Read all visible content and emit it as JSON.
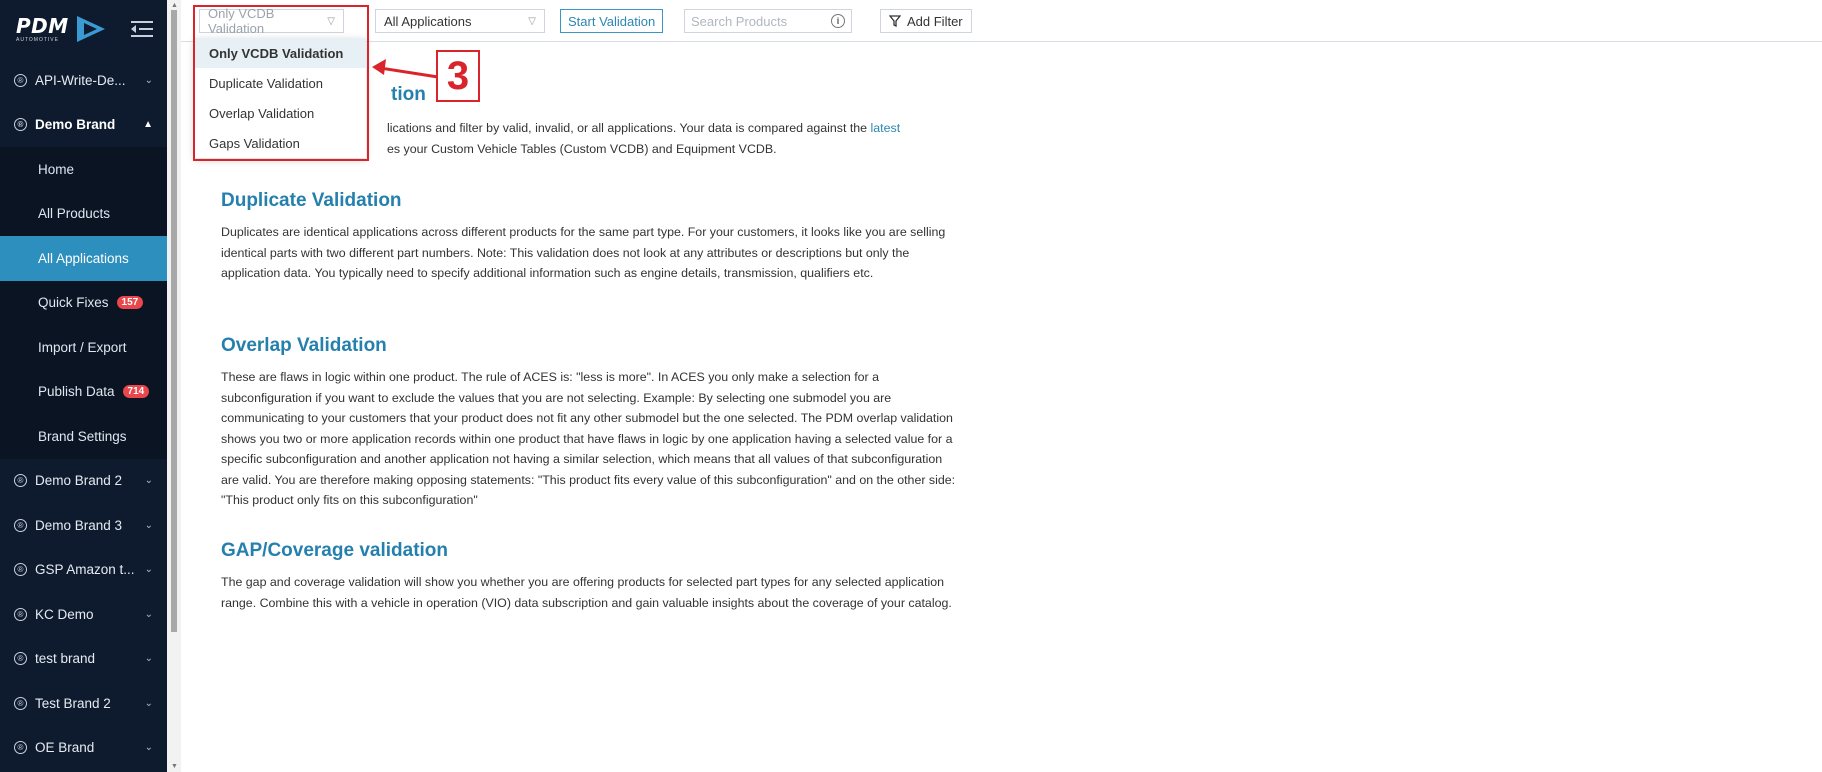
{
  "colors": {
    "sidebar_bg": "#0e1b2e",
    "active_item": "#2c8fbe",
    "accent": "#2580ad",
    "badge": "#e9474b",
    "annotation": "#d9242b"
  },
  "logo": {
    "text": "PDM",
    "sub": "AUTOMOTIVE"
  },
  "sidebar": {
    "brands_top": [
      {
        "label": "API-Write-De...",
        "icon": "registered-icon"
      }
    ],
    "open_brand": {
      "label": "Demo Brand",
      "icon": "registered-icon"
    },
    "sub_items": [
      {
        "label": "Home"
      },
      {
        "label": "All Products"
      },
      {
        "label": "All Applications",
        "active": true
      },
      {
        "label": "Quick Fixes",
        "badge": "157"
      },
      {
        "label": "Import / Export"
      },
      {
        "label": "Publish Data",
        "badge": "714"
      },
      {
        "label": "Brand Settings"
      }
    ],
    "brands_bottom": [
      {
        "label": "Demo Brand 2"
      },
      {
        "label": "Demo Brand 3"
      },
      {
        "label": "GSP Amazon t..."
      },
      {
        "label": "KC Demo"
      },
      {
        "label": "test brand"
      },
      {
        "label": "Test Brand 2"
      },
      {
        "label": "OE Brand"
      }
    ]
  },
  "toolbar": {
    "validation_select": "Only VCDB Validation",
    "applications_select": "All Applications",
    "start_button": "Start Validation",
    "search_placeholder": "Search Products",
    "filter_button": "Add Filter"
  },
  "dropdown": {
    "options": [
      "Only VCDB Validation",
      "Duplicate Validation",
      "Overlap Validation",
      "Gaps Validation"
    ],
    "selected": "Only VCDB Validation"
  },
  "annotation": {
    "number": "3"
  },
  "content": {
    "vcdb_title_fragment": "tion",
    "vcdb_line1_a": "lications and filter by valid, invalid, or all applications. Your data is compared against the ",
    "vcdb_line1_link": "latest",
    "vcdb_line2": "es your Custom Vehicle Tables (Custom VCDB) and Equipment VCDB.",
    "duplicate_title": "Duplicate Validation",
    "duplicate_text": "Duplicates are identical applications across different products for the same part type. For your customers, it looks like you are selling identical parts with two different part numbers. Note: This validation does not look at any attributes or descriptions but only the application data. You typically need to specify additional information such as engine details, transmission, qualifiers etc.",
    "overlap_title": "Overlap Validation",
    "overlap_text": "These are flaws in logic within one product. The rule of ACES is: \"less is more\". In ACES you only make a selection for a subconfiguration if you want to exclude the values that you are not selecting. Example: By selecting one submodel you are communicating to your customers that your product does not fit any other submodel but the one selected. The PDM overlap validation shows you two or more application records within one product that have flaws in logic by one application having a selected value for a specific subconfiguration and another application not having a similar selection, which means that all values of that subconfiguration are valid. You are therefore making opposing statements: \"This product fits every value of this subconfiguration\" and on the other side: \"This product only fits on this subconfiguration\"",
    "gap_title": "GAP/Coverage validation",
    "gap_text": "The gap and coverage validation will show you whether you are offering products for selected part types for any selected application range. Combine this with a vehicle in operation (VIO) data subscription and gain valuable insights about the coverage of your catalog."
  }
}
